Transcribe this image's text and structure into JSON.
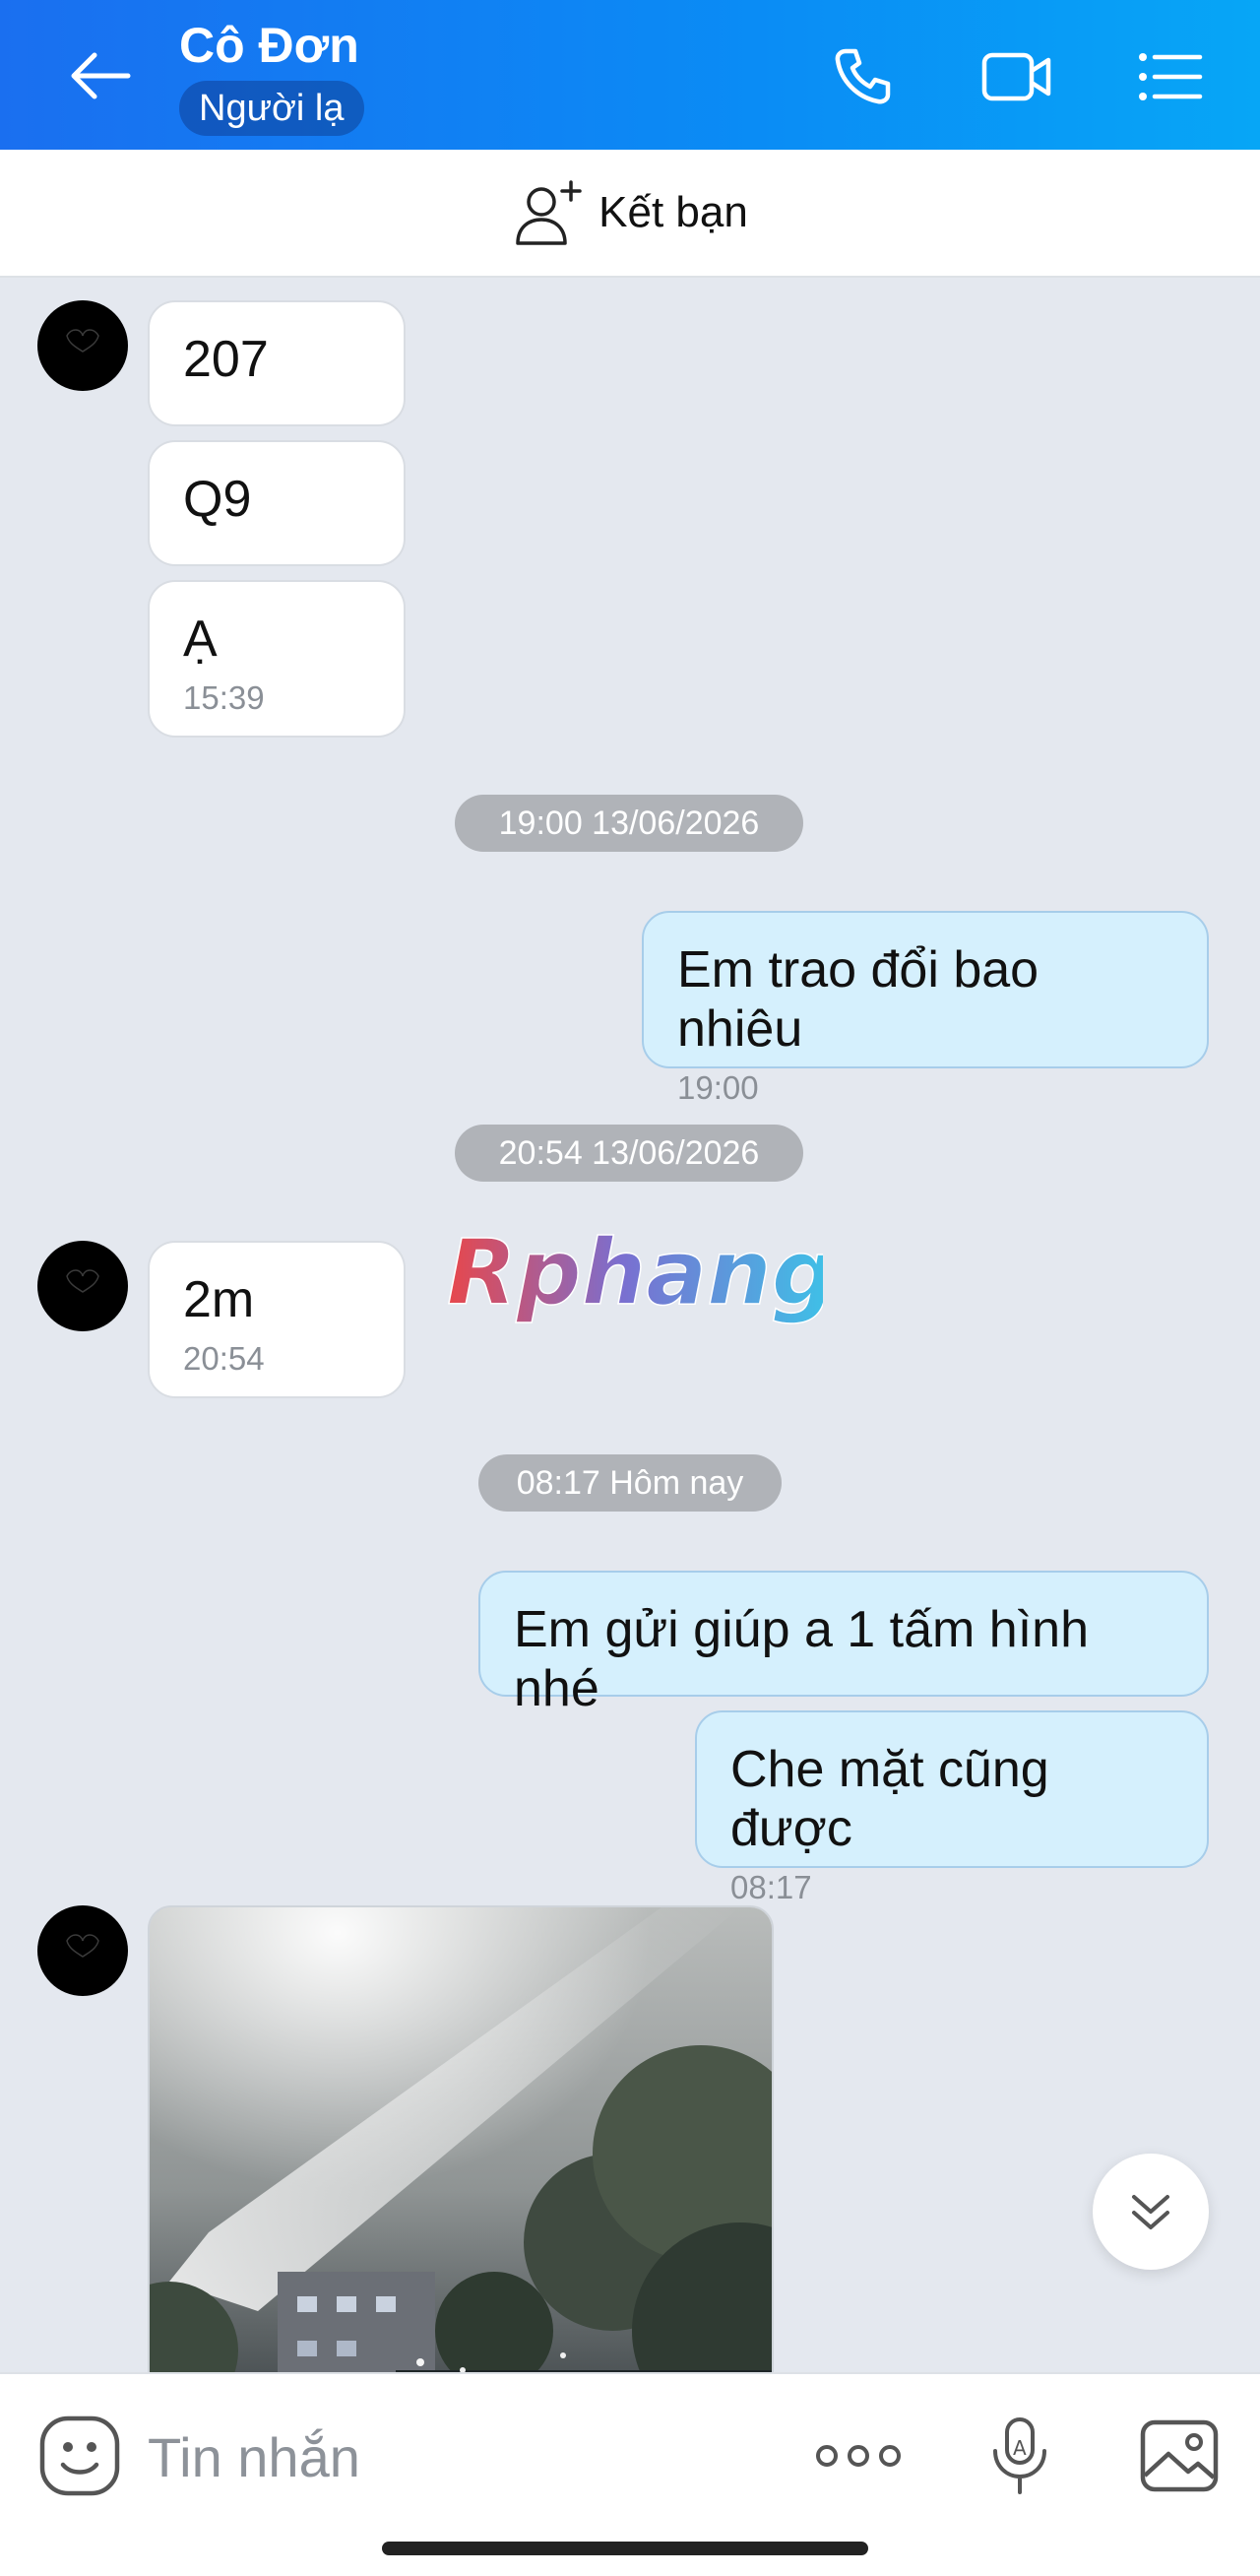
{
  "header": {
    "back_icon": "arrow-left-icon",
    "title": "Cô Đơn",
    "badge": "Người lạ",
    "icons": [
      "phone-icon",
      "video-call-icon",
      "list-menu-icon"
    ]
  },
  "friend_bar": {
    "icon": "add-person-icon",
    "label": "Kết bạn"
  },
  "messages": [
    {
      "side": "in",
      "text": "207"
    },
    {
      "side": "in",
      "text": "Q9"
    },
    {
      "side": "in",
      "text": "Ạ",
      "time": "15:39"
    },
    {
      "divider": "19:00 13/06/2026"
    },
    {
      "side": "out",
      "text": "Em trao đổi bao nhiêu",
      "time": "19:00"
    },
    {
      "divider": "20:54 13/06/2026"
    },
    {
      "side": "in",
      "text": "2m",
      "time": "20:54"
    },
    {
      "divider": "08:17 Hôm nay"
    },
    {
      "side": "out",
      "text": "Em gửi giúp a 1 tấm hình nhé"
    },
    {
      "side": "out",
      "text": "Che mặt cũng được",
      "time": "08:17"
    },
    {
      "side": "in",
      "type": "photo"
    }
  ],
  "watermark": "Rphang",
  "scroll_button_icon": "chevron-double-down-icon",
  "input_bar": {
    "placeholder": "Tin nhắn",
    "icons": [
      "emoji-icon",
      "more-dots-icon",
      "voice-text-icon",
      "image-icon"
    ]
  },
  "colors": {
    "header_start": "#1a6ff0",
    "header_end": "#07a6f6",
    "outgoing_bubble": "#d5f0fd",
    "incoming_bubble": "#ffffff",
    "chat_background": "#e4e8ef"
  }
}
